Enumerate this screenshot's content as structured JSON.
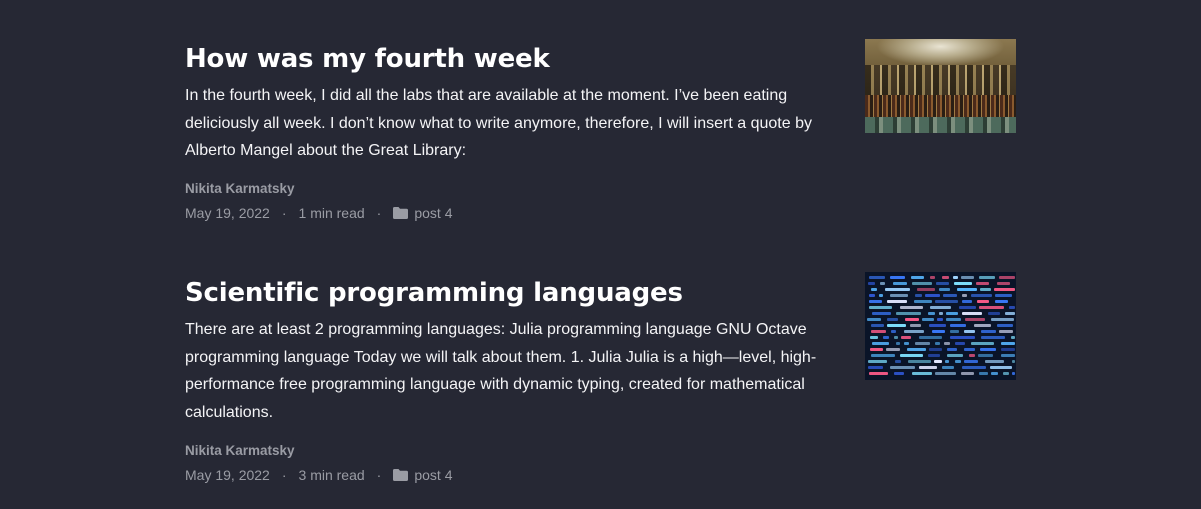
{
  "posts": [
    {
      "title": "How was my fourth week",
      "summary": "In the fourth week, I did all the labs that are available at the moment. I’ve been eating deliciously all week. I don’t know what to write anymore, therefore, I will insert a quote by Alberto Mangel about the Great Library:",
      "author": "Nikita Karmatsky",
      "date": "May 19, 2022",
      "read_time": "1 min read",
      "category": "post 4",
      "category_icon": "folder-icon",
      "separator": "·"
    },
    {
      "title": "Scientific programming languages",
      "summary": "There are at least 2 programming languages: Julia programming language GNU Octave programming language Today we will talk about them. 1. Julia Julia is a high—level, high-performance free programming language with dynamic typing, created for mathematical calculations.",
      "author": "Nikita Karmatsky",
      "date": "May 19, 2022",
      "read_time": "3 min read",
      "category": "post 4",
      "category_icon": "folder-icon",
      "separator": "·"
    }
  ],
  "colors": {
    "background": "#262834",
    "title": "#ffffff",
    "text": "#f4f4f6",
    "meta": "#9a9ca4"
  }
}
